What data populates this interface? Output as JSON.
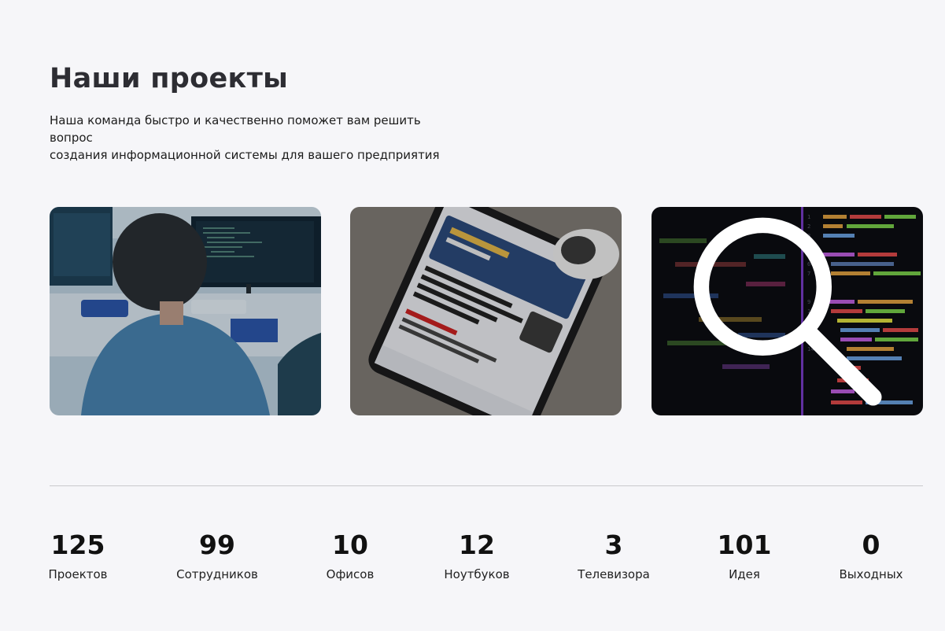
{
  "header": {
    "title": "Наши проекты",
    "subtitle_line1": "Наша команда быстро и качественно поможет вам решить вопрос",
    "subtitle_line2": "создания информационной системы для вашего предприятия"
  },
  "projects": [
    {
      "image": "developer-at-monitors-photo"
    },
    {
      "image": "smartphone-news-app-photo"
    },
    {
      "image": "code-editor-screen-photo",
      "overlay_icon": "search-icon"
    }
  ],
  "stats": [
    {
      "value": "125",
      "label": "Проектов"
    },
    {
      "value": "99",
      "label": "Сотрудников"
    },
    {
      "value": "10",
      "label": "Офисов"
    },
    {
      "value": "12",
      "label": "Ноутбуков"
    },
    {
      "value": "3",
      "label": "Телевизора"
    },
    {
      "value": "101",
      "label": "Идея"
    },
    {
      "value": "0",
      "label": "Выходных"
    }
  ],
  "colors": {
    "background": "#f6f6f9",
    "title": "#2d2d33",
    "divider": "#c9c9cc"
  }
}
